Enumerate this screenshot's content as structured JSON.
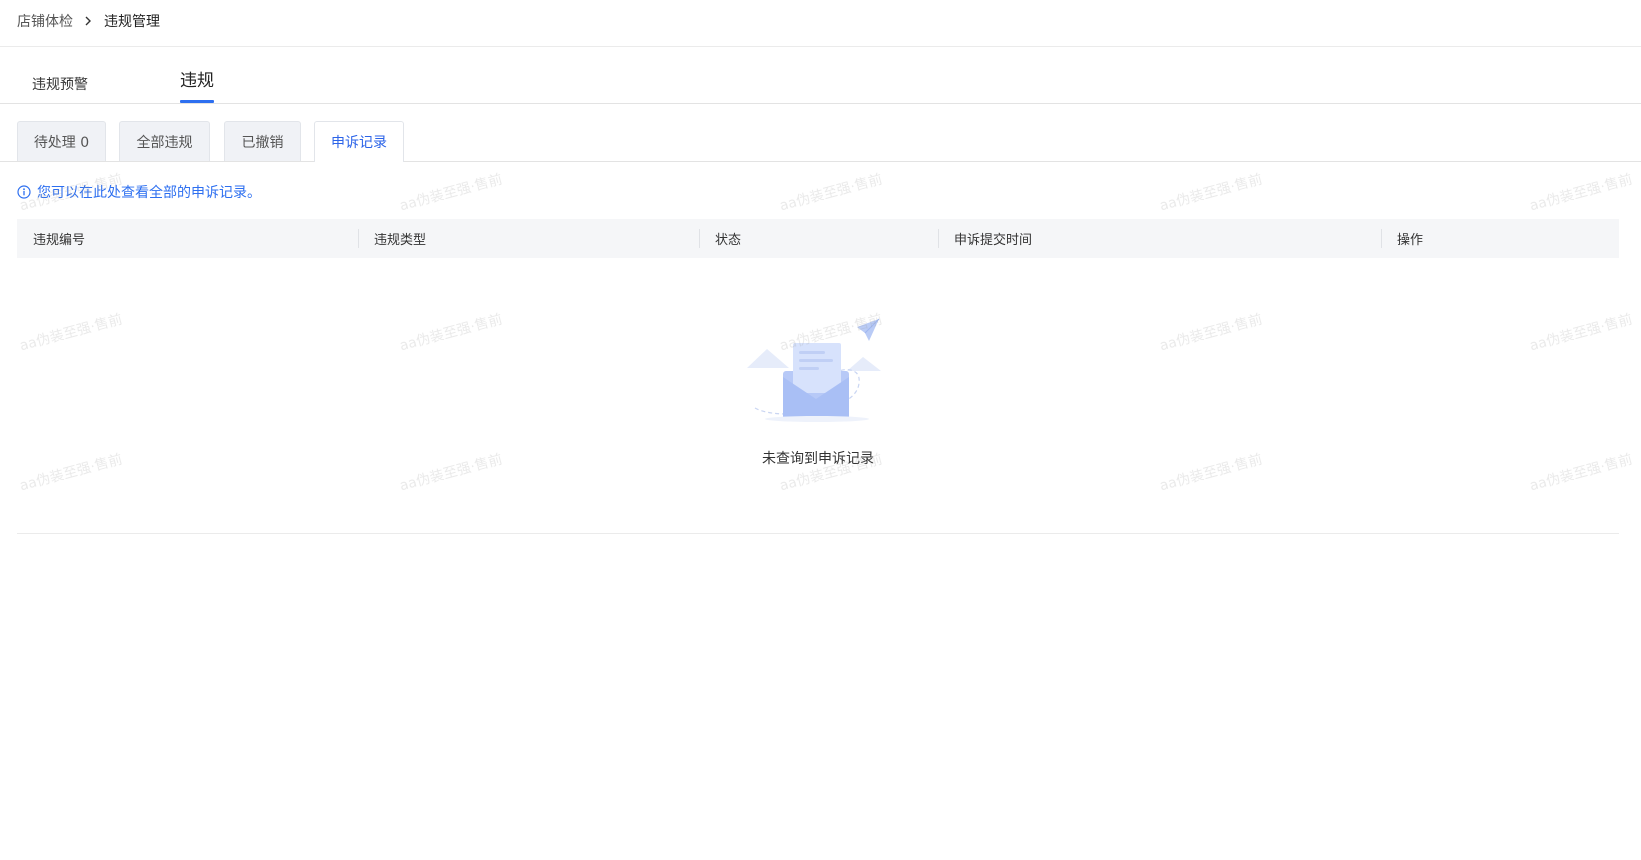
{
  "breadcrumb": {
    "parent": "店铺体检",
    "current": "违规管理"
  },
  "top_tabs": {
    "warning": "违规预警",
    "violation": "违规"
  },
  "card_tabs": {
    "pending": "待处理 0",
    "all": "全部违规",
    "revoked": "已撤销",
    "appeals": "申诉记录"
  },
  "notice": {
    "text": "您可以在此处查看全部的申诉记录。"
  },
  "table": {
    "columns": [
      "违规编号",
      "违规类型",
      "状态",
      "申诉提交时间",
      "操作"
    ],
    "empty_text": "未查询到申诉记录"
  },
  "watermark": "aa伪装至强·售前",
  "colors": {
    "accent": "#2d6ff0",
    "active_tab_text": "#2b63e8",
    "header_bg": "#f5f6f8"
  }
}
